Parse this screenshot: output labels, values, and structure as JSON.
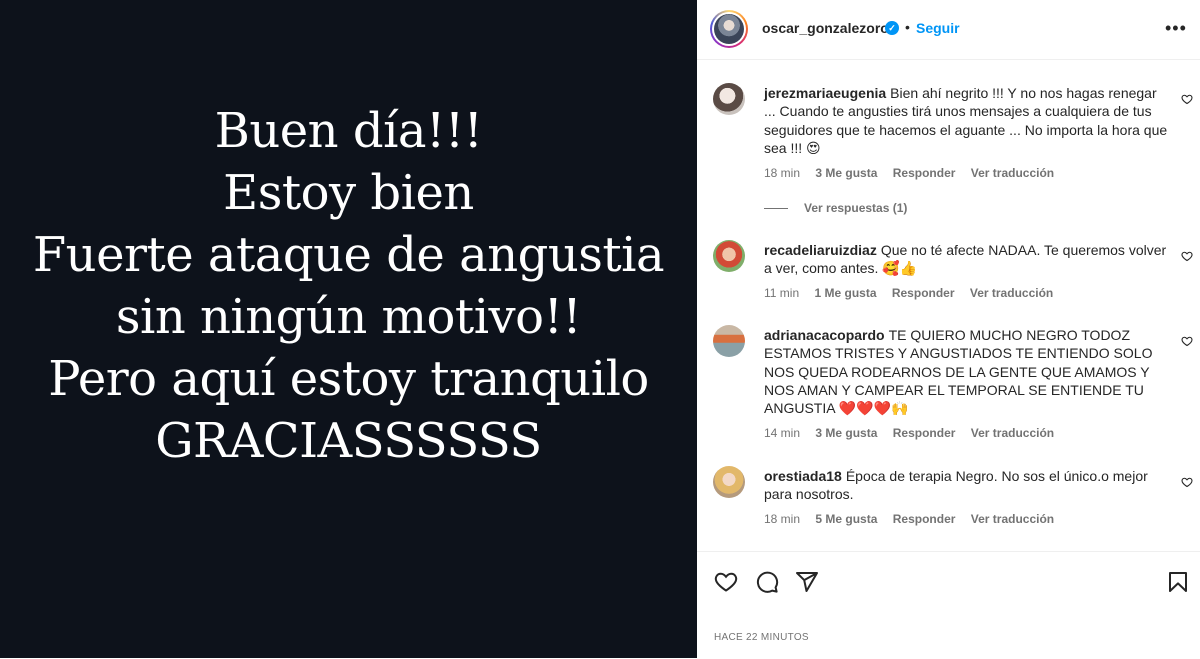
{
  "post": {
    "lines": [
      "Buen día!!!",
      "Estoy bien",
      "Fuerte ataque de angustia",
      "sin ningún motivo!!",
      "Pero aquí estoy tranquilo",
      "GRACIASSSSSS"
    ]
  },
  "header": {
    "username": "oscar_gonzalezoro",
    "verified_icon": "✓",
    "separator": "•",
    "follow_label": "Seguir",
    "more_icon": "•••"
  },
  "comments": [
    {
      "user": "jerezmariaeugenia",
      "text": "Bien ahí negrito !!! Y no nos hagas renegar ... Cuando te angusties tirá unos mensajes a cualquiera de tus seguidores que te hacemos el aguante ... No importa la hora que sea !!!",
      "emoji": "😍",
      "time": "18 min",
      "likes": "3 Me gusta",
      "reply": "Responder",
      "translate": "Ver traducción",
      "view_replies": "Ver respuestas (1)"
    },
    {
      "user": "recadeliaruizdiaz",
      "text": "Que no té afecte NADAA. Te queremos volver a ver, como antes.",
      "emoji": "🥰👍",
      "time": "11 min",
      "likes": "1 Me gusta",
      "reply": "Responder",
      "translate": "Ver traducción"
    },
    {
      "user": "adrianacacopardo",
      "text": "TE QUIERO MUCHO NEGRO TODOZ ESTAMOS TRISTES Y ANGUSTIADOS TE ENTIENDO SOLO NOS QUEDA RODEARNOS DE LA GENTE QUE AMAMOS Y NOS AMAN Y CAMPEAR EL TEMPORAL SE ENTIENDE TU ANGUSTIA",
      "emoji": "❤️❤️❤️🙌",
      "time": "14 min",
      "likes": "3 Me gusta",
      "reply": "Responder",
      "translate": "Ver traducción"
    },
    {
      "user": "orestiada18",
      "text": "Época de terapia Negro. No sos el único.o mejor para nosotros.",
      "emoji": "",
      "time": "18 min",
      "likes": "5 Me gusta",
      "reply": "Responder",
      "translate": "Ver traducción"
    }
  ],
  "footer": {
    "timestamp": "HACE 22 MINUTOS"
  },
  "colors": {
    "accent": "#0095f6",
    "post_bg": "#0d121b",
    "muted": "#737373"
  }
}
